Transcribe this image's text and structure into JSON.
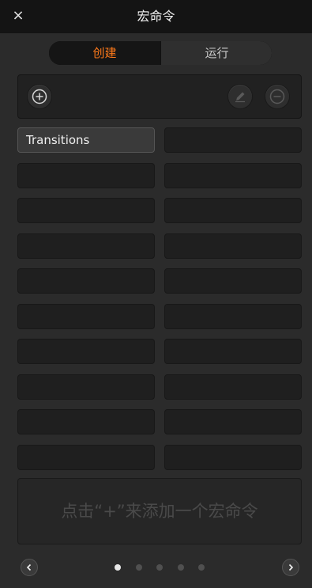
{
  "window": {
    "title": "宏命令",
    "close_label": "×"
  },
  "tabs": {
    "create_label": "创建",
    "run_label": "运行",
    "active": "create"
  },
  "toolbar": {
    "add_icon": "plus-circle-icon",
    "edit_icon": "pencil-icon",
    "remove_icon": "minus-circle-icon"
  },
  "macros": {
    "slots": [
      {
        "label": "Transitions"
      },
      {
        "label": ""
      },
      {
        "label": ""
      },
      {
        "label": ""
      },
      {
        "label": ""
      },
      {
        "label": ""
      },
      {
        "label": ""
      },
      {
        "label": ""
      },
      {
        "label": ""
      },
      {
        "label": ""
      },
      {
        "label": ""
      },
      {
        "label": ""
      },
      {
        "label": ""
      },
      {
        "label": ""
      },
      {
        "label": ""
      },
      {
        "label": ""
      },
      {
        "label": ""
      },
      {
        "label": ""
      },
      {
        "label": ""
      },
      {
        "label": ""
      }
    ]
  },
  "hint": {
    "text": "点击“+”来添加一个宏命令"
  },
  "pagination": {
    "page_count": 5,
    "current_page": 1
  },
  "colors": {
    "accent": "#ff7a1a",
    "background": "#2b2b2b",
    "titlebar": "#141414"
  }
}
